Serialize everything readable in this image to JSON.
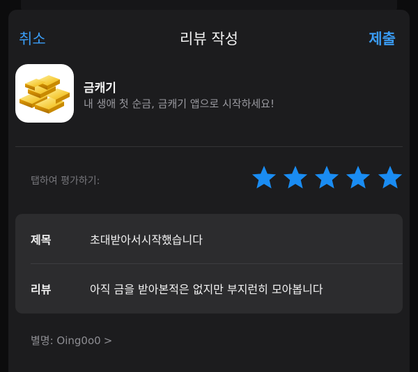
{
  "nav": {
    "cancel_label": "취소",
    "title": "리뷰 작성",
    "submit_label": "제출"
  },
  "app": {
    "name": "금캐기",
    "subtitle": "내 생애 첫 순금, 금캐기 앱으로 시작하세요!",
    "icon": "gold-bars-icon"
  },
  "rating": {
    "label": "탭하여 평가하기:",
    "value": 5,
    "max": 5,
    "star_color": "#1a8cf2"
  },
  "form": {
    "title_label": "제목",
    "title_value": "초대받아서시작했습니다",
    "review_label": "리뷰",
    "review_value": "아직 금을 받아본적은 없지만 부지런히 모아봅니다"
  },
  "alias": {
    "text": "별명: Oing0o0",
    "chevron": ">"
  },
  "colors": {
    "accent": "#3a9cf4",
    "background": "#1c1c1e",
    "card": "#2c2c2e"
  }
}
